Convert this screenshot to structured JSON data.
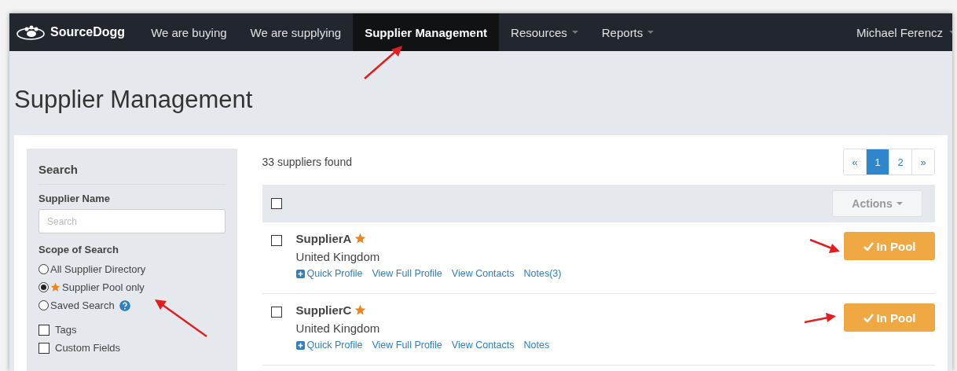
{
  "nav": {
    "logo": "SourceDogg",
    "items": [
      {
        "label": "We are buying",
        "selected": false,
        "dropdown": false
      },
      {
        "label": "We are supplying",
        "selected": false,
        "dropdown": false
      },
      {
        "label": "Supplier Management",
        "selected": true,
        "dropdown": false
      },
      {
        "label": "Resources",
        "selected": false,
        "dropdown": true
      },
      {
        "label": "Reports",
        "selected": false,
        "dropdown": true
      }
    ],
    "user": "Michael Ferencz"
  },
  "page_title": "Supplier Management",
  "search": {
    "title": "Search",
    "name_label": "Supplier Name",
    "placeholder": "Search",
    "scope_label": "Scope of Search",
    "scopes": [
      {
        "label": "All Supplier Directory",
        "selected": false,
        "kind": "plain"
      },
      {
        "label": "Supplier Pool only",
        "selected": true,
        "kind": "starred"
      },
      {
        "label": "Saved Search",
        "selected": false,
        "kind": "help"
      }
    ],
    "filters": [
      {
        "label": "Tags",
        "checked": false
      },
      {
        "label": "Custom Fields",
        "checked": false
      }
    ]
  },
  "results": {
    "count": "33 suppliers found",
    "pagination": [
      {
        "label": "«",
        "selected": false
      },
      {
        "label": "1",
        "selected": true
      },
      {
        "label": "2",
        "selected": false
      },
      {
        "label": "»",
        "selected": false
      }
    ],
    "select_all": false,
    "actions": "Actions",
    "suppliers": [
      {
        "name": "SupplierA",
        "starred": true,
        "country": "United Kingdom",
        "checked": false,
        "links": [
          {
            "label": "Quick Profile",
            "kind": "quick"
          },
          {
            "label": "View Full Profile",
            "kind": "plain"
          },
          {
            "label": "View Contacts",
            "kind": "plain"
          },
          {
            "label": "Notes(3)",
            "kind": "plain"
          }
        ],
        "status": "In Pool"
      },
      {
        "name": "SupplierC",
        "starred": true,
        "country": "United Kingdom",
        "checked": false,
        "links": [
          {
            "label": "Quick Profile",
            "kind": "quick"
          },
          {
            "label": "View Full Profile",
            "kind": "plain"
          },
          {
            "label": "View Contacts",
            "kind": "plain"
          },
          {
            "label": "Notes",
            "kind": "plain"
          }
        ],
        "status": "In Pool"
      }
    ]
  }
}
